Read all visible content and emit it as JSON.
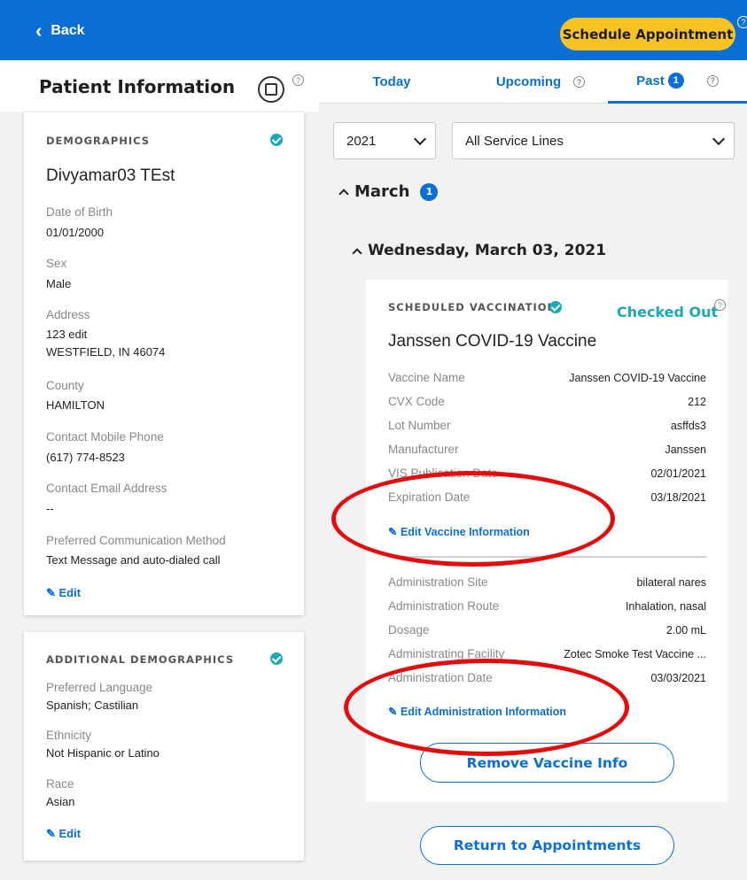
{
  "topbar": {
    "back_label": "Back",
    "schedule_label": "Schedule Appointment",
    "help_mark": "?"
  },
  "left": {
    "title": "Patient Information",
    "help_mark": "?",
    "demographics": {
      "label": "DEMOGRAPHICS",
      "name": "Divyamar03 TEst",
      "fields": [
        {
          "label": "Date of Birth",
          "value": "01/01/2000"
        },
        {
          "label": "Sex",
          "value": "Male"
        },
        {
          "label": "Address",
          "value": "123 edit",
          "value2": "WESTFIELD, IN 46074"
        },
        {
          "label": "County",
          "value": "HAMILTON"
        },
        {
          "label": "Contact Mobile Phone",
          "value": "(617) 774-8523"
        },
        {
          "label": "Contact Email Address",
          "value": "--"
        },
        {
          "label": "Preferred Communication Method",
          "value": "Text Message and auto-dialed call"
        }
      ],
      "edit_label": "Edit"
    },
    "additional": {
      "label": "ADDITIONAL DEMOGRAPHICS",
      "fields": [
        {
          "label": "Preferred Language",
          "value": "Spanish; Castilian"
        },
        {
          "label": "Ethnicity",
          "value": "Not Hispanic or Latino"
        },
        {
          "label": "Race",
          "value": "Asian"
        }
      ],
      "edit_label": "Edit"
    }
  },
  "right": {
    "tabs": [
      {
        "label": "Today"
      },
      {
        "label": "Upcoming",
        "help": "?"
      },
      {
        "label": "Past",
        "count": "1",
        "help": "?"
      }
    ],
    "year_select": "2021",
    "service_select": "All Service Lines",
    "month": {
      "label": "March",
      "count": "1"
    },
    "day": {
      "label": "Wednesday, March 03, 2021"
    },
    "vaccination": {
      "label": "SCHEDULED VACCINATION",
      "status": "Checked Out",
      "status_help": "?",
      "title": "Janssen COVID-19 Vaccine",
      "vaccine_fields": [
        {
          "label": "Vaccine Name",
          "value": "Janssen COVID-19 Vaccine"
        },
        {
          "label": "CVX Code",
          "value": "212"
        },
        {
          "label": "Lot Number",
          "value": "asffds3"
        },
        {
          "label": "Manufacturer",
          "value": "Janssen"
        },
        {
          "label": "VIS Publication Date",
          "value": "02/01/2021"
        },
        {
          "label": "Expiration Date",
          "value": "03/18/2021"
        }
      ],
      "edit_vaccine_label": "Edit Vaccine Information",
      "admin_fields": [
        {
          "label": "Administration Site",
          "value": "bilateral nares"
        },
        {
          "label": "Administration Route",
          "value": "Inhalation, nasal"
        },
        {
          "label": "Dosage",
          "value": "2.00 mL"
        },
        {
          "label": "Administrating Facility",
          "value": "Zotec Smoke Test Vaccine ..."
        },
        {
          "label": "Administration Date",
          "value": "03/03/2021"
        }
      ],
      "edit_admin_label": "Edit Administration Information",
      "remove_label": "Remove Vaccine Info"
    },
    "return_label": "Return to Appointments"
  },
  "colors": {
    "brand_blue": "#0b6fd4",
    "accent_yellow": "#f7c324",
    "check_teal": "#1ba8b8",
    "annotation_red": "#e40d0d"
  }
}
